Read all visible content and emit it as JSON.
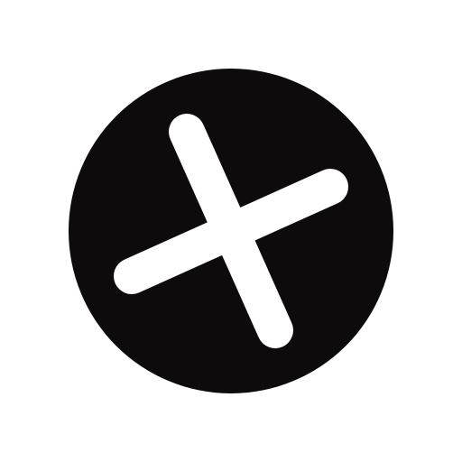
{
  "icon": {
    "name": "close-x-circle-icon",
    "background_color": "#ffffff",
    "circle_color": "#0d0b0c",
    "cross_color": "#ffffff"
  }
}
